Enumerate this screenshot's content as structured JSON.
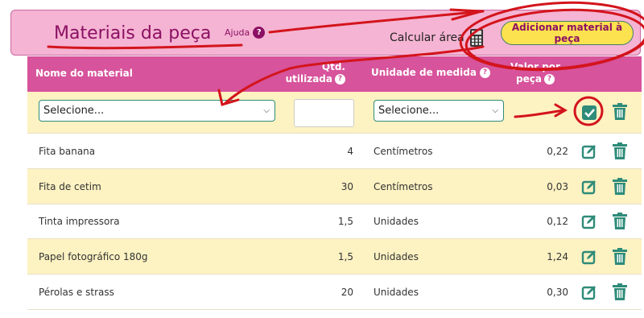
{
  "header": {
    "title": "Materiais da peça",
    "help_label": "Ajuda",
    "calc_label": "Calcular área",
    "add_button": "Adicionar material à peça"
  },
  "table": {
    "columns": [
      "Nome do material",
      "Qtd. utilizada",
      "Unidade de medida",
      "Valor por peça"
    ],
    "new_row": {
      "material_placeholder": "Selecione...",
      "unit_placeholder": "Selecione...",
      "quantity": ""
    },
    "rows": [
      {
        "name": "Fita banana",
        "qty": "4",
        "unit": "Centímetros",
        "value": "0,22"
      },
      {
        "name": "Fita de cetim",
        "qty": "30",
        "unit": "Centímetros",
        "value": "0,03"
      },
      {
        "name": "Tinta impressora",
        "qty": "1,5",
        "unit": "Unidades",
        "value": "0,12"
      },
      {
        "name": "Papel fotográfico 180g",
        "qty": "1,5",
        "unit": "Unidades",
        "value": "1,24"
      },
      {
        "name": "Pérolas e strass",
        "qty": "20",
        "unit": "Unidades",
        "value": "0,30"
      }
    ]
  },
  "colors": {
    "accent": "#d7539b",
    "header_bg": "#f5b4d3",
    "title": "#8c1063",
    "teal": "#2e8b79",
    "row_alt": "#fdf2c2",
    "button": "#fde24f",
    "annotation": "#d3141c"
  },
  "icons": [
    "help-icon",
    "calculator-icon",
    "chevron-down-icon",
    "confirm-check-icon",
    "edit-icon",
    "trash-icon"
  ]
}
